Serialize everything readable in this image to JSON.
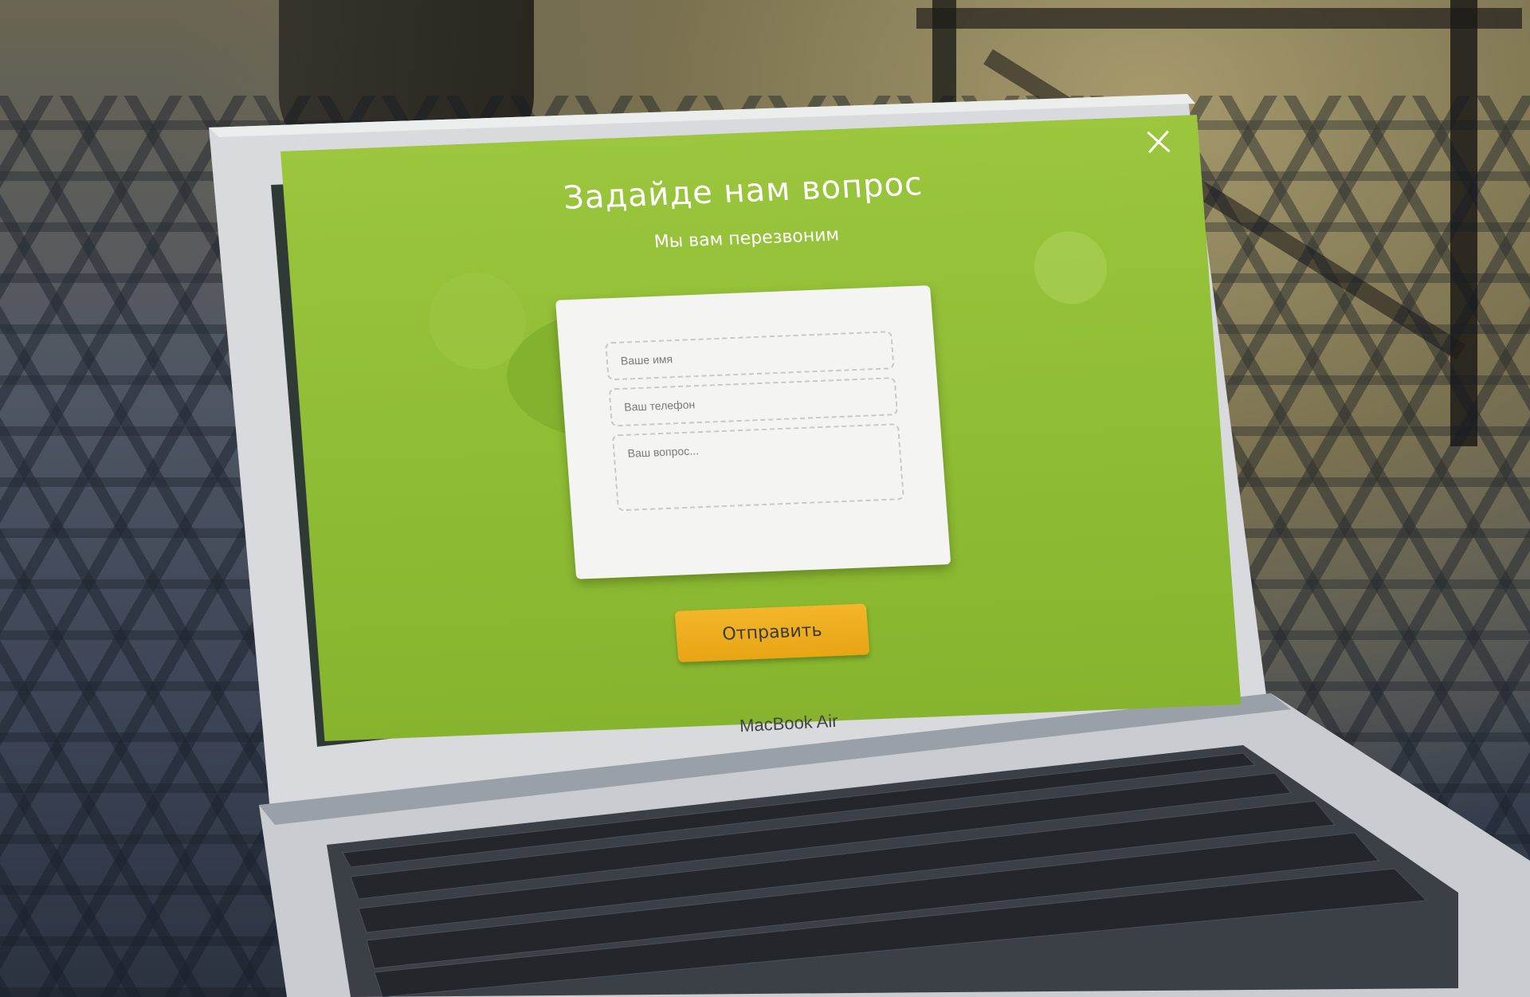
{
  "screen": {
    "title": "Задайде нам вопрос",
    "subtitle": "Мы вам перезвоним",
    "accent_color": "#8fbd35",
    "close_icon": "close-icon"
  },
  "form": {
    "name_placeholder": "Ваше имя",
    "phone_placeholder": "Ваш телефон",
    "question_placeholder": "Ваш вопрос...",
    "submit_label": "Отправить",
    "submit_color": "#f0b020"
  },
  "device": {
    "label": "MacBook Air"
  }
}
